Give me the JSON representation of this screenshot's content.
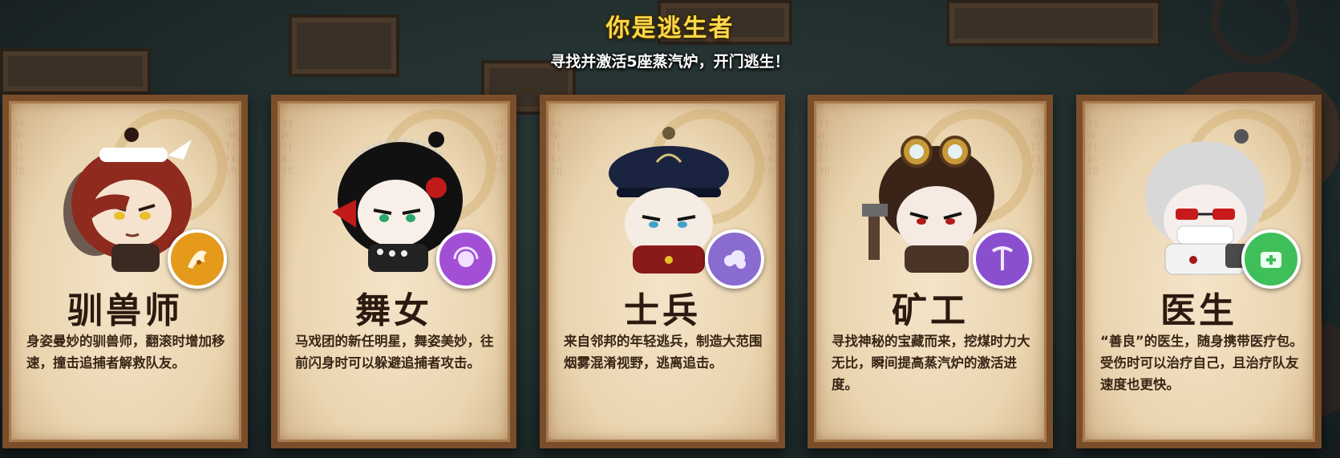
{
  "header": {
    "title": "你是逃生者",
    "subtitle": "寻找并激活5座蒸汽炉，开门逃生！"
  },
  "cards": [
    {
      "name": "驯兽师",
      "description": "身姿曼妙的驯兽师，翻滚时增加移速，撞击追捕者解救队友。",
      "skill_icon": "beast-dash-icon",
      "skill_color": "#e59a1c"
    },
    {
      "name": "舞女",
      "description": "马戏团的新任明星，舞姿美妙，往前闪身时可以躲避追捕者攻击。",
      "skill_icon": "dance-dodge-icon",
      "skill_color": "#a24fd6"
    },
    {
      "name": "士兵",
      "description": "来自邻邦的年轻逃兵，制造大范围烟雾混淆视野，逃离追击。",
      "skill_icon": "smoke-icon",
      "skill_color": "#8a6bd0"
    },
    {
      "name": "矿工",
      "description": "寻找神秘的宝藏而来，挖煤时力大无比，瞬间提高蒸汽炉的激活进度。",
      "skill_icon": "pickaxe-icon",
      "skill_color": "#8a4fcf"
    },
    {
      "name": "医生",
      "description": "“善良”的医生，随身携带医疗包。受伤时可以治疗自己，且治疗队友速度也更快。",
      "skill_icon": "medkit-icon",
      "skill_color": "#3fbf5a"
    }
  ]
}
